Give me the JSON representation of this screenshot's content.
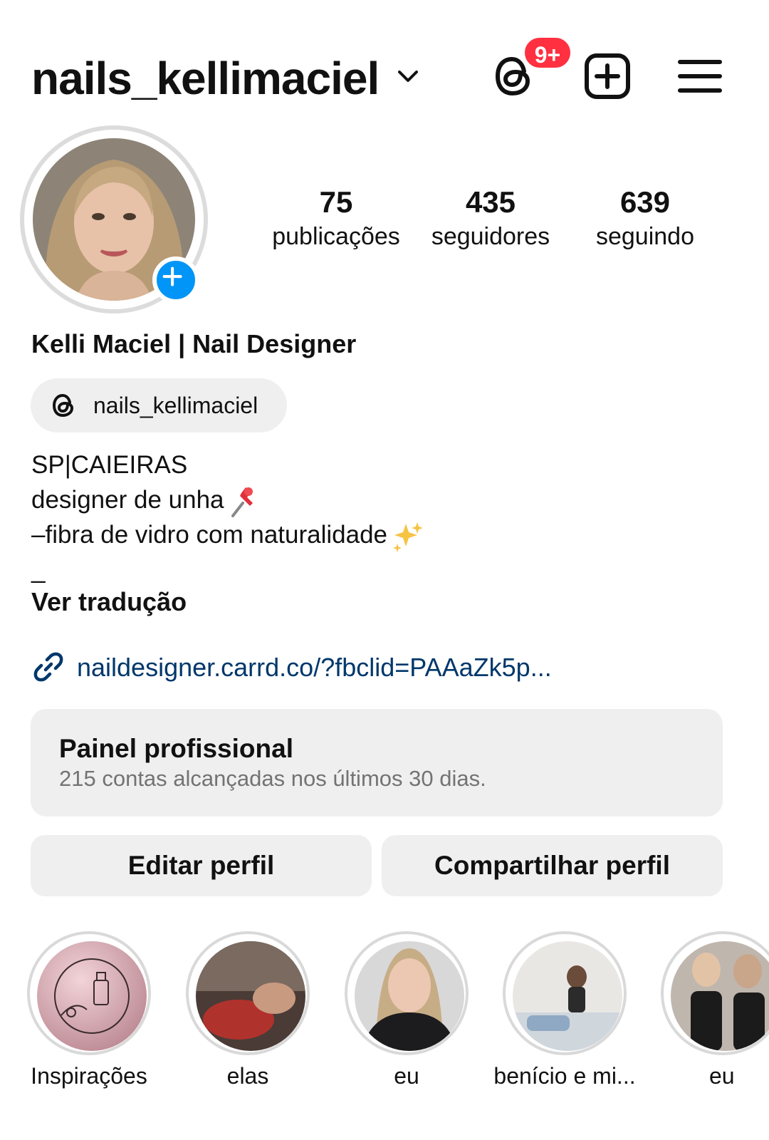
{
  "header": {
    "username": "nails_kellimaciel",
    "notification_badge": "9+",
    "icons": [
      "chevron-down-icon",
      "threads-icon",
      "create-icon",
      "menu-icon"
    ]
  },
  "stats": [
    {
      "value": "75",
      "label": "publicações"
    },
    {
      "value": "435",
      "label": "seguidores"
    },
    {
      "value": "639",
      "label": "seguindo"
    }
  ],
  "profile": {
    "full_name": "Kelli Maciel | Nail Designer",
    "threads_handle": "nails_kellimaciel",
    "bio_lines": [
      "SP|CAIEIRAS",
      "designer de unha",
      "–fibra de vidro com naturalidade",
      "_"
    ],
    "see_translation": "Ver tradução",
    "link": "naildesigner.carrd.co/?fbclid=PAAaZk5p..."
  },
  "professional_dashboard": {
    "title": "Painel profissional",
    "subtitle": "215 contas alcançadas nos últimos 30 dias."
  },
  "buttons": {
    "edit": "Editar perfil",
    "share": "Compartilhar perfil"
  },
  "highlights": [
    {
      "label": "Inspirações"
    },
    {
      "label": "elas"
    },
    {
      "label": "eu"
    },
    {
      "label": "benício e mi..."
    },
    {
      "label": "eu"
    }
  ],
  "colors": {
    "badge": "#ff3040",
    "add_story": "#0095f6",
    "link": "#00376b",
    "chip_bg": "#efefef"
  }
}
